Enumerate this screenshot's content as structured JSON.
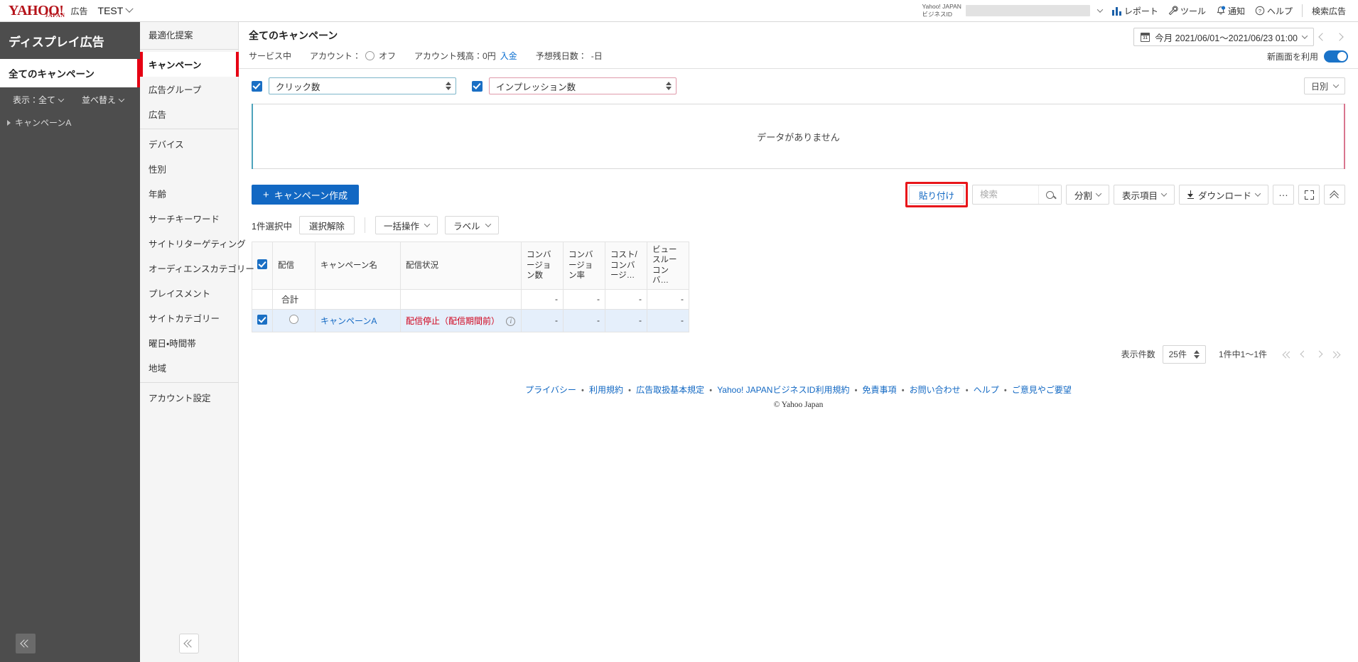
{
  "header": {
    "logo_main": "YAHOO!",
    "logo_sub": "JAPAN",
    "logo_suffix": "広告",
    "account_name": "TEST",
    "bizid_line1": "Yahoo! JAPAN",
    "bizid_line2": "ビジネスID",
    "bizid_value": "",
    "nav": [
      {
        "label": "レポート",
        "icon": "bar-chart-icon"
      },
      {
        "label": "ツール",
        "icon": "wrench-icon"
      },
      {
        "label": "通知",
        "icon": "bell-icon"
      },
      {
        "label": "ヘルプ",
        "icon": "question-circle-icon"
      }
    ],
    "search_ads_link": "検索広告"
  },
  "sidebar": {
    "title": "ディスプレイ広告",
    "all_campaigns": "全てのキャンペーン",
    "filter_display": "表示：全て",
    "filter_sort": "並べ替え",
    "tree": [
      {
        "label": "キャンペーンA"
      }
    ]
  },
  "navcol": {
    "items": [
      {
        "label": "最適化提案",
        "active": false,
        "divider_after": true
      },
      {
        "label": "キャンペーン",
        "active": true,
        "divider_after": false
      },
      {
        "label": "広告グループ",
        "active": false,
        "divider_after": false
      },
      {
        "label": "広告",
        "active": false,
        "divider_after": true
      },
      {
        "label": "デバイス",
        "active": false,
        "divider_after": false
      },
      {
        "label": "性別",
        "active": false,
        "divider_after": false
      },
      {
        "label": "年齢",
        "active": false,
        "divider_after": false
      },
      {
        "label": "サーチキーワード",
        "active": false,
        "divider_after": false
      },
      {
        "label": "サイトリターゲティング",
        "active": false,
        "divider_after": false
      },
      {
        "label": "オーディエンスカテゴリー",
        "active": false,
        "divider_after": false
      },
      {
        "label": "プレイスメント",
        "active": false,
        "divider_after": false
      },
      {
        "label": "サイトカテゴリー",
        "active": false,
        "divider_after": false
      },
      {
        "label": "曜日・時間帯",
        "active": false,
        "divider_after": false
      },
      {
        "label": "地域",
        "active": false,
        "divider_after": true
      },
      {
        "label": "アカウント設定",
        "active": false,
        "divider_after": false
      }
    ]
  },
  "page": {
    "title": "全てのキャンペーン",
    "status": "サービス中",
    "account_label": "アカウント：",
    "account_value": "オフ",
    "balance_label": "アカウント残高：0円",
    "balance_link": "入金",
    "remaining_label": "予想残日数：",
    "remaining_value": "-日",
    "date_range": "今月 2021/06/01〜2021/06/23 01:00",
    "calendar_icon_day": "31",
    "new_ui_label": "新画面を利用",
    "new_ui_on": true
  },
  "chart_data": {
    "type": "line",
    "title": "",
    "empty_message": "データがありません",
    "granularity": "日別",
    "series": [
      {
        "name": "クリック数",
        "enabled": true,
        "axis": "left",
        "color": "#4da3bb",
        "values": []
      },
      {
        "name": "インプレッション数",
        "enabled": true,
        "axis": "right",
        "color": "#d9758f",
        "values": []
      }
    ],
    "x": [],
    "xlabel": "",
    "ylabel": "",
    "grid": false,
    "legend_position": "top"
  },
  "toolbar": {
    "create_campaign": "キャンペーン作成",
    "paste": "貼り付け",
    "search_placeholder": "検索",
    "search_value": "",
    "split": "分割",
    "columns": "表示項目",
    "download": "ダウンロード",
    "more": "…"
  },
  "selection": {
    "count_label": "1件選択中",
    "deselect": "選択解除",
    "bulk_action": "一括操作",
    "label_menu": "ラベル"
  },
  "table": {
    "columns": [
      "配信",
      "キャンペーン名",
      "配信状況",
      "コンバージョン数",
      "コンバージョン率",
      "コスト/コンバージ…",
      "ビュースルーコンバ…"
    ],
    "total_row": {
      "label": "合計",
      "values": [
        "-",
        "-",
        "-",
        "-"
      ]
    },
    "rows": [
      {
        "selected": true,
        "delivery": "off",
        "name": "キャンペーンA",
        "status": "配信停止（配信期間前）",
        "has_info": true,
        "values": [
          "-",
          "-",
          "-",
          "-"
        ]
      }
    ]
  },
  "pagination": {
    "rows_label": "表示件数",
    "rows_value": "25件",
    "range": "1件中1〜1件"
  },
  "footer": {
    "links": [
      "プライバシー",
      "利用規約",
      "広告取扱基本規定",
      "Yahoo! JAPANビジネスID利用規約",
      "免責事項",
      "お問い合わせ",
      "ヘルプ",
      "ご意見やご要望"
    ],
    "copyright": "© Yahoo Japan"
  }
}
